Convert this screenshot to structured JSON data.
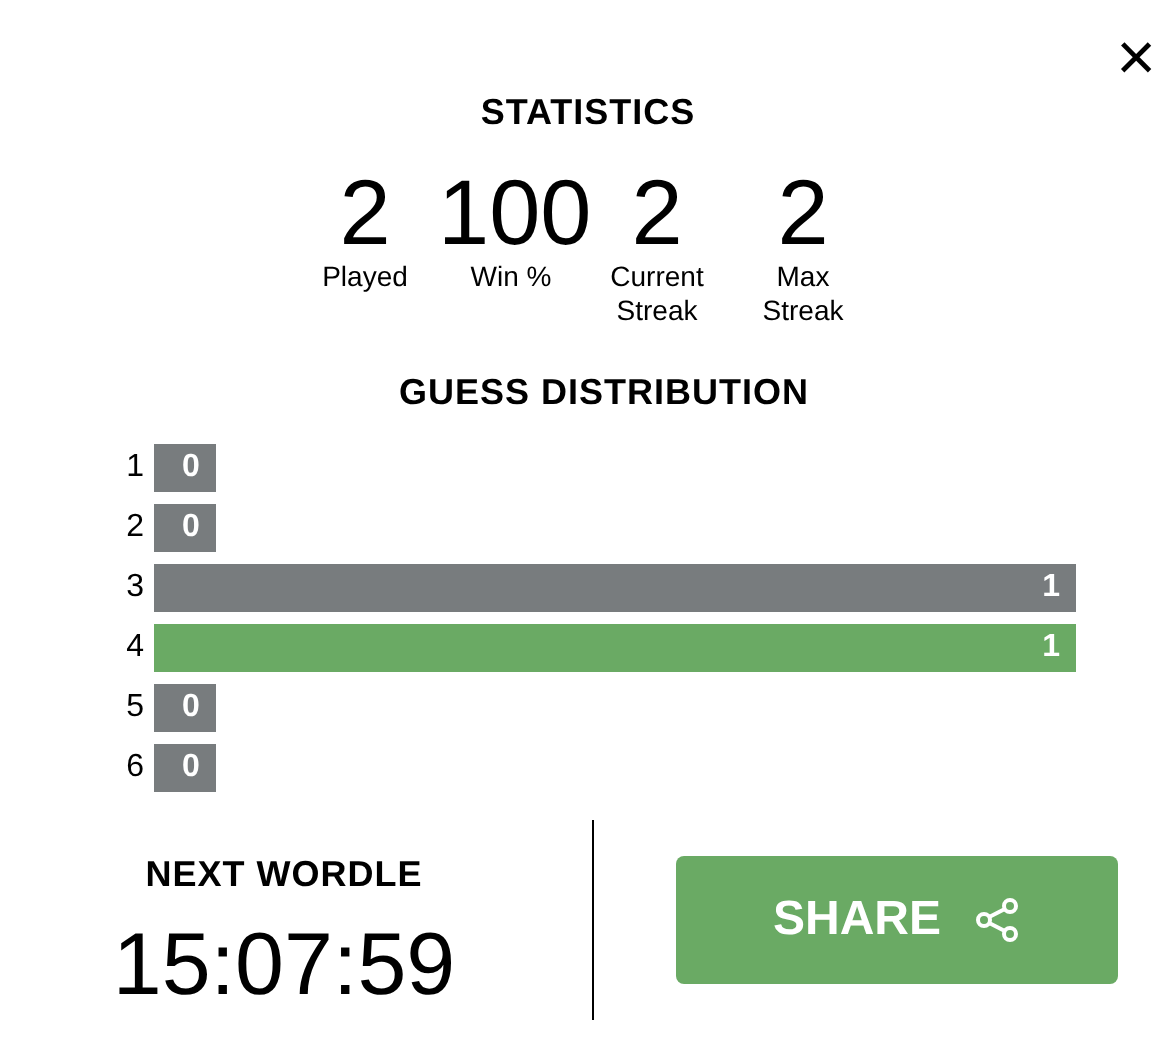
{
  "close": {
    "label": "×"
  },
  "title": "STATISTICS",
  "stats": [
    {
      "value": "2",
      "label": "Played"
    },
    {
      "value": "100",
      "label": "Win %"
    },
    {
      "value": "2",
      "label": "Current Streak"
    },
    {
      "value": "2",
      "label": "Max Streak"
    }
  ],
  "distribution": {
    "title": "GUESS DISTRIBUTION",
    "rows": [
      {
        "guess": "1",
        "count": "0",
        "selected": false
      },
      {
        "guess": "2",
        "count": "0",
        "selected": false
      },
      {
        "guess": "3",
        "count": "1",
        "selected": false
      },
      {
        "guess": "4",
        "count": "1",
        "selected": true
      },
      {
        "guess": "5",
        "count": "0",
        "selected": false
      },
      {
        "guess": "6",
        "count": "0",
        "selected": false
      }
    ]
  },
  "next": {
    "title": "NEXT WORDLE",
    "timer": "15:07:59"
  },
  "share": {
    "label": "SHARE"
  }
}
